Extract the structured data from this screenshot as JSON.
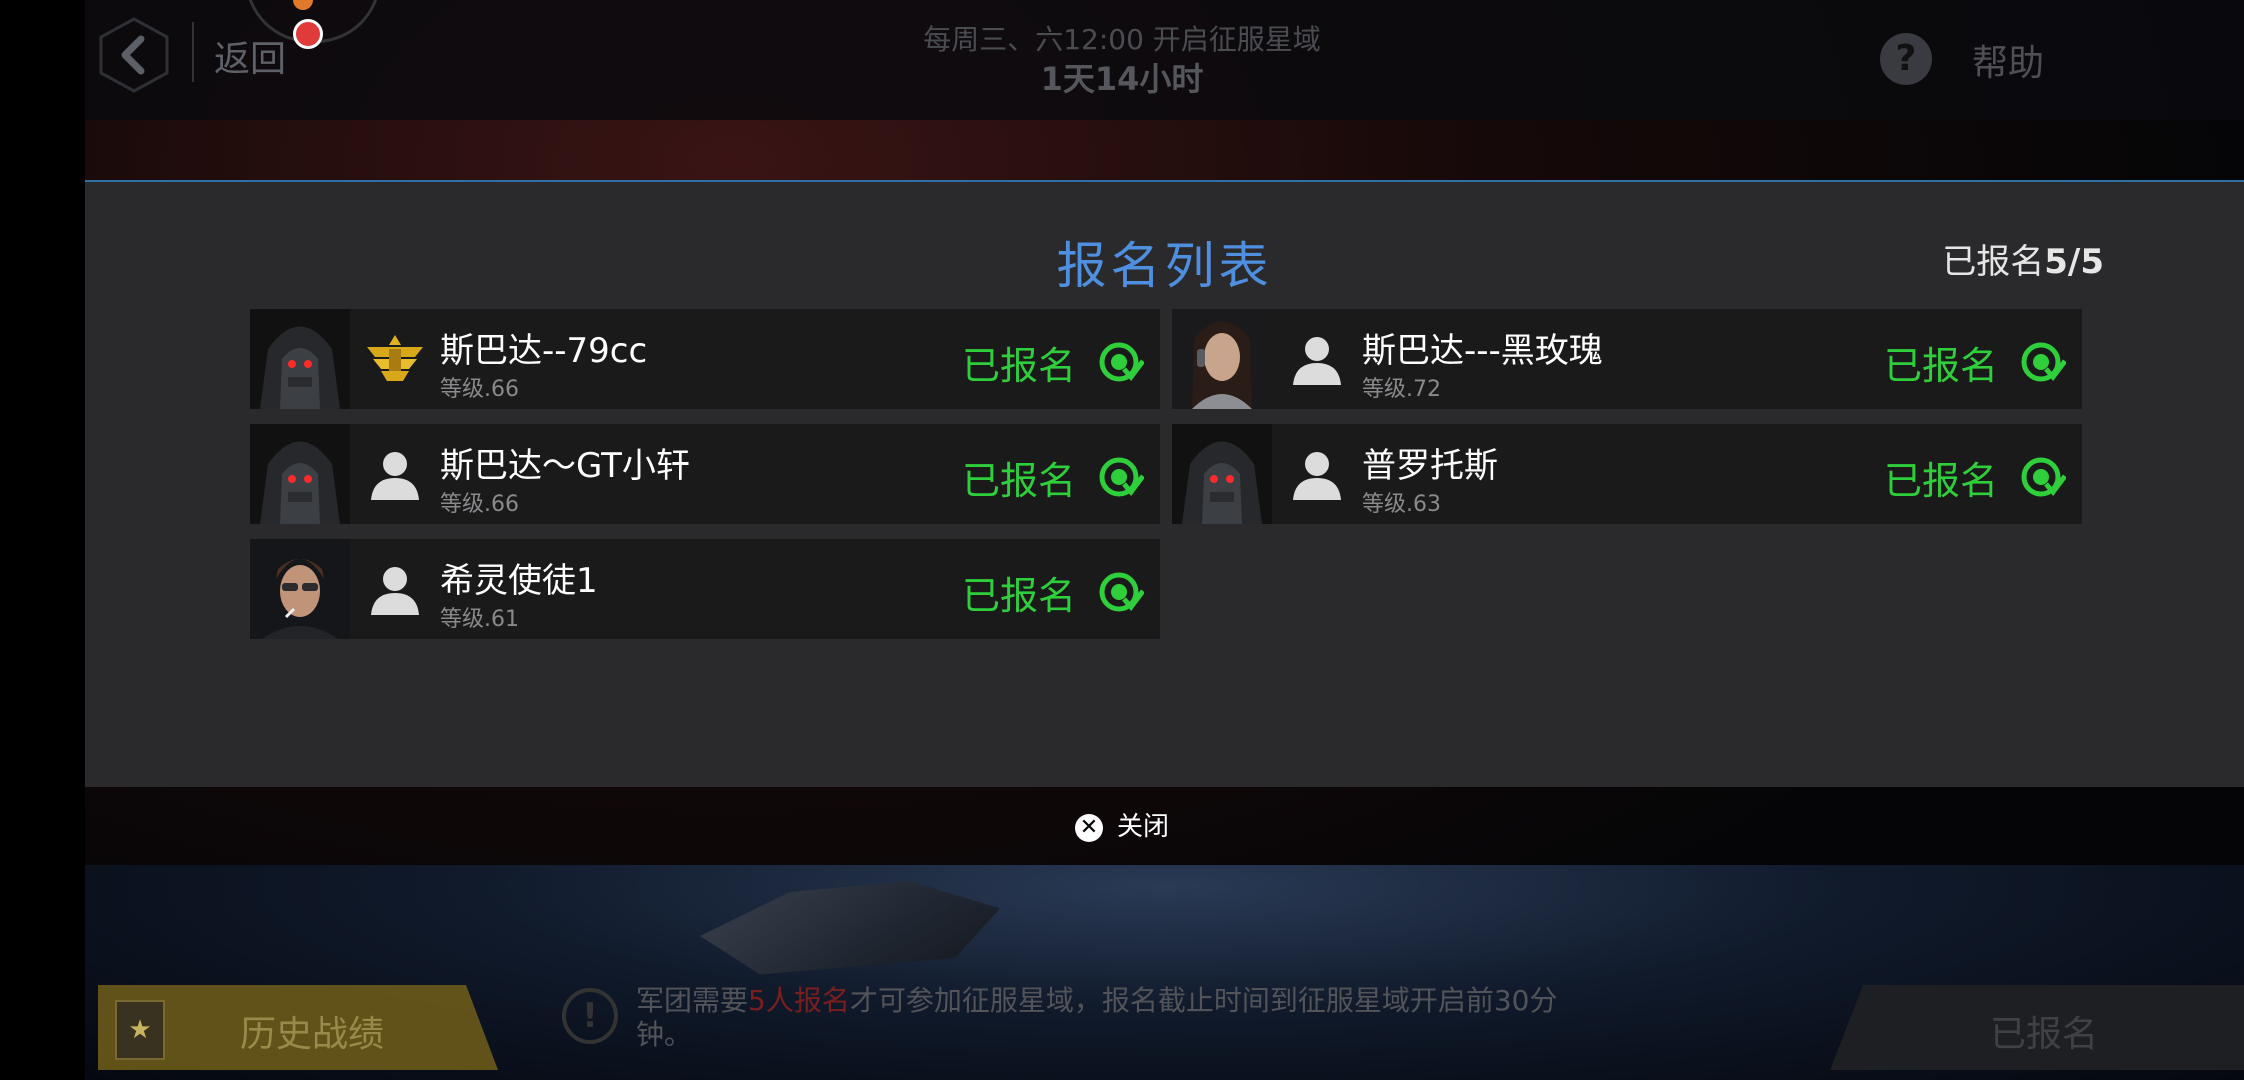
{
  "topbar": {
    "back_label": "返回",
    "schedule": "每周三、六12:00 开启征服星域",
    "countdown": "1天14小时",
    "help_label": "帮助"
  },
  "modal": {
    "title": "报名列表",
    "count_prefix": "已报名",
    "count_value": "5/5",
    "close_label": "关闭",
    "players": [
      {
        "name": "斯巴达--79cc",
        "level": "等级.66",
        "status": "已报名",
        "badge": "gold-rank-icon",
        "portrait": "hooded-red-eyes"
      },
      {
        "name": "斯巴达---黑玫瑰",
        "level": "等级.72",
        "status": "已报名",
        "badge": "user-silhouette-icon",
        "portrait": "woman-headset"
      },
      {
        "name": "斯巴达～GT小轩",
        "level": "等级.66",
        "status": "已报名",
        "badge": "user-silhouette-icon",
        "portrait": "hooded-red-eyes"
      },
      {
        "name": "普罗托斯",
        "level": "等级.63",
        "status": "已报名",
        "badge": "user-silhouette-icon",
        "portrait": "hooded-red-eyes"
      },
      {
        "name": "希灵使徒1",
        "level": "等级.61",
        "status": "已报名",
        "badge": "user-silhouette-icon",
        "portrait": "man-sunglasses"
      }
    ]
  },
  "bottom": {
    "history_label": "历史战绩",
    "notice_pre": "军团需要",
    "notice_highlight": "5人报名",
    "notice_post": "才可参加征服星域，报名截止时间到征服星域开启前30分钟。",
    "signup_label": "已报名"
  },
  "colors": {
    "title_blue": "#4f8fe0",
    "status_green": "#2fcf3c",
    "modal_bg": "#2a2a2c"
  }
}
